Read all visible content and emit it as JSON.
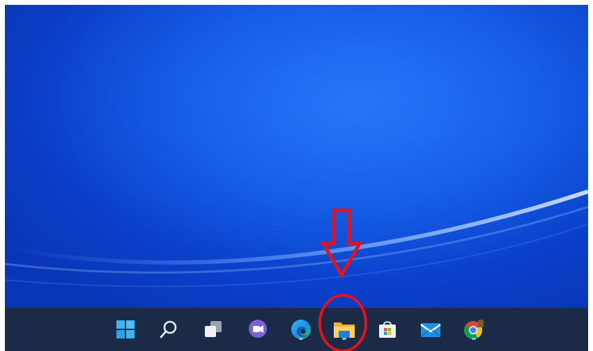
{
  "desktop": {
    "wallpaper": "windows-11-blue-bloom",
    "colors": {
      "base": "#0a3fc9",
      "highlight": "#1f6cf0",
      "taskbar": "#1b2a47",
      "annotation": "#e3131b"
    }
  },
  "taskbar": {
    "items": [
      {
        "name": "start",
        "icon": "windows-logo-icon",
        "running": false
      },
      {
        "name": "search",
        "icon": "search-icon",
        "running": false
      },
      {
        "name": "task-view",
        "icon": "task-view-icon",
        "running": false
      },
      {
        "name": "chat",
        "icon": "teams-chat-icon",
        "running": false
      },
      {
        "name": "edge",
        "icon": "edge-browser-icon",
        "running": true
      },
      {
        "name": "file-explorer",
        "icon": "folder-icon",
        "running": true
      },
      {
        "name": "store",
        "icon": "microsoft-store-icon",
        "running": false
      },
      {
        "name": "mail",
        "icon": "mail-icon",
        "running": false
      },
      {
        "name": "chrome",
        "icon": "chrome-icon",
        "running": true
      }
    ]
  },
  "annotation": {
    "target": "file-explorer",
    "shapes": [
      "down-arrow",
      "circle"
    ]
  }
}
